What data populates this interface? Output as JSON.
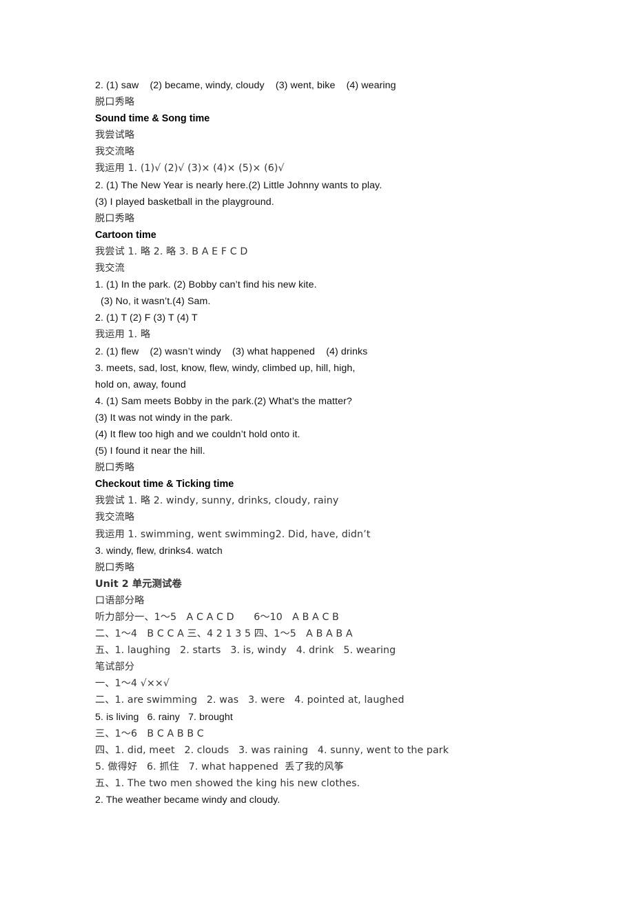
{
  "document": {
    "type": "answer-key",
    "page_background": "#ffffff",
    "text_color": "#111111",
    "lines": [
      {
        "id": "l1",
        "style": "normal",
        "text": "2. (1) saw    (2) became, windy, cloudy    (3) went, bike    (4) wearing"
      },
      {
        "id": "l2",
        "style": "normal",
        "text": "脱口秀略"
      },
      {
        "id": "l3",
        "style": "heading",
        "text": "Sound time & Song time"
      },
      {
        "id": "l4",
        "style": "normal",
        "text": "我尝试略"
      },
      {
        "id": "l5",
        "style": "normal",
        "text": "我交流略"
      },
      {
        "id": "l6",
        "style": "normal",
        "text": "我运用 1. (1)√ (2)√ (3)× (4)× (5)× (6)√"
      },
      {
        "id": "l7",
        "style": "normal",
        "text": "2. (1) The New Year is nearly here.(2) Little Johnny wants to play."
      },
      {
        "id": "l8",
        "style": "normal",
        "text": "(3) I played basketball in the playground."
      },
      {
        "id": "l9",
        "style": "normal",
        "text": "脱口秀略"
      },
      {
        "id": "l10",
        "style": "heading",
        "text": "Cartoon time"
      },
      {
        "id": "l11",
        "style": "normal",
        "text": "我尝试 1. 略 2. 略 3. B A E F C D"
      },
      {
        "id": "l12",
        "style": "normal",
        "text": "我交流"
      },
      {
        "id": "l13",
        "style": "normal",
        "text": "1. (1) In the park. (2) Bobby can’t find his new kite."
      },
      {
        "id": "l14",
        "style": "indent",
        "text": "(3) No, it wasn’t.(4) Sam."
      },
      {
        "id": "l15",
        "style": "normal",
        "text": "2. (1) T (2) F (3) T (4) T"
      },
      {
        "id": "l16",
        "style": "normal",
        "text": "我运用 1. 略"
      },
      {
        "id": "l17",
        "style": "normal",
        "text": "2. (1) flew    (2) wasn’t windy    (3) what happened    (4) drinks"
      },
      {
        "id": "l18",
        "style": "normal",
        "text": "3. meets, sad, lost, know, flew, windy, climbed up, hill, high,"
      },
      {
        "id": "l19",
        "style": "normal",
        "text": "hold on, away, found"
      },
      {
        "id": "l20",
        "style": "normal",
        "text": "4. (1) Sam meets Bobby in the park.(2) What’s the matter?"
      },
      {
        "id": "l21",
        "style": "normal",
        "text": "(3) It was not windy in the park."
      },
      {
        "id": "l22",
        "style": "normal",
        "text": "(4) It flew too high and we couldn’t hold onto it."
      },
      {
        "id": "l23",
        "style": "normal",
        "text": "(5) I found it near the hill."
      },
      {
        "id": "l24",
        "style": "normal",
        "text": "脱口秀略"
      },
      {
        "id": "l25",
        "style": "heading",
        "text": "Checkout time & Ticking time"
      },
      {
        "id": "l26",
        "style": "normal",
        "text": "我尝试 1. 略 2. windy, sunny, drinks, cloudy, rainy"
      },
      {
        "id": "l27",
        "style": "normal",
        "text": "我交流略"
      },
      {
        "id": "l28",
        "style": "normal",
        "text": "我运用 1. swimming, went swimming2. Did, have, didn’t"
      },
      {
        "id": "l29",
        "style": "normal",
        "text": "3. windy, flew, drinks4. watch"
      },
      {
        "id": "l30",
        "style": "normal",
        "text": "脱口秀略"
      },
      {
        "id": "l31",
        "style": "heading",
        "text": "Unit 2 单元测试卷"
      },
      {
        "id": "l32",
        "style": "normal",
        "text": "口语部分略"
      },
      {
        "id": "l33",
        "style": "normal",
        "text": "听力部分一、1～5　A C A C D　　6～10　A B A C B"
      },
      {
        "id": "l34",
        "style": "normal",
        "text": "二、1～4　B C C A 三、4 2 1 3 5 四、1～5　A B A B A"
      },
      {
        "id": "l35",
        "style": "normal",
        "text": "五、1. laughing   2. starts   3. is, windy   4. drink   5. wearing"
      },
      {
        "id": "l36",
        "style": "normal",
        "text": "笔试部分"
      },
      {
        "id": "l37",
        "style": "normal",
        "text": "一、1～4 √××√"
      },
      {
        "id": "l38",
        "style": "normal",
        "text": "二、1. are swimming   2. was   3. were   4. pointed at, laughed"
      },
      {
        "id": "l39",
        "style": "normal",
        "text": "5. is living   6. rainy   7. brought"
      },
      {
        "id": "l40",
        "style": "normal",
        "text": "三、1～6　B C A B B C"
      },
      {
        "id": "l41",
        "style": "normal",
        "text": "四、1. did, meet   2. clouds   3. was raining   4. sunny, went to the park"
      },
      {
        "id": "l42",
        "style": "normal",
        "text": "5. 做得好   6. 抓住   7. what happened  丢了我的风筝"
      },
      {
        "id": "l43",
        "style": "normal",
        "text": "五、1. The two men showed the king his new clothes."
      },
      {
        "id": "l44",
        "style": "normal",
        "text": "2. The weather became windy and cloudy."
      }
    ]
  }
}
